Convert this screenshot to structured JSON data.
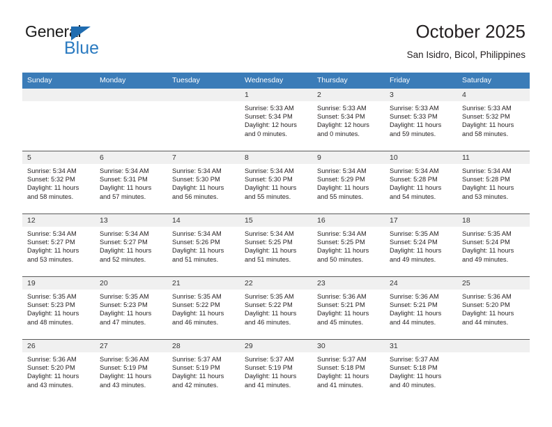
{
  "brand": {
    "name_top": "General",
    "name_bottom": "Blue",
    "accent_color": "#2a7ac0",
    "triangle_color": "#1f6cb0"
  },
  "header": {
    "title": "October 2025",
    "subtitle": "San Isidro, Bicol, Philippines",
    "header_bar_color": "#3b7cb8",
    "daynum_band_color": "#f0f0f0"
  },
  "weekdays": [
    "Sunday",
    "Monday",
    "Tuesday",
    "Wednesday",
    "Thursday",
    "Friday",
    "Saturday"
  ],
  "labels": {
    "sunrise_prefix": "Sunrise: ",
    "sunset_prefix": "Sunset: ",
    "daylight_prefix": "Daylight: "
  },
  "weeks": [
    [
      {
        "day": "",
        "sunrise": "",
        "sunset": "",
        "daylight": "",
        "empty": true
      },
      {
        "day": "",
        "sunrise": "",
        "sunset": "",
        "daylight": "",
        "empty": true
      },
      {
        "day": "",
        "sunrise": "",
        "sunset": "",
        "daylight": "",
        "empty": true
      },
      {
        "day": "1",
        "sunrise": "Sunrise: 5:33 AM",
        "sunset": "Sunset: 5:34 PM",
        "daylight": "Daylight: 12 hours and 0 minutes."
      },
      {
        "day": "2",
        "sunrise": "Sunrise: 5:33 AM",
        "sunset": "Sunset: 5:34 PM",
        "daylight": "Daylight: 12 hours and 0 minutes."
      },
      {
        "day": "3",
        "sunrise": "Sunrise: 5:33 AM",
        "sunset": "Sunset: 5:33 PM",
        "daylight": "Daylight: 11 hours and 59 minutes."
      },
      {
        "day": "4",
        "sunrise": "Sunrise: 5:33 AM",
        "sunset": "Sunset: 5:32 PM",
        "daylight": "Daylight: 11 hours and 58 minutes."
      }
    ],
    [
      {
        "day": "5",
        "sunrise": "Sunrise: 5:34 AM",
        "sunset": "Sunset: 5:32 PM",
        "daylight": "Daylight: 11 hours and 58 minutes."
      },
      {
        "day": "6",
        "sunrise": "Sunrise: 5:34 AM",
        "sunset": "Sunset: 5:31 PM",
        "daylight": "Daylight: 11 hours and 57 minutes."
      },
      {
        "day": "7",
        "sunrise": "Sunrise: 5:34 AM",
        "sunset": "Sunset: 5:30 PM",
        "daylight": "Daylight: 11 hours and 56 minutes."
      },
      {
        "day": "8",
        "sunrise": "Sunrise: 5:34 AM",
        "sunset": "Sunset: 5:30 PM",
        "daylight": "Daylight: 11 hours and 55 minutes."
      },
      {
        "day": "9",
        "sunrise": "Sunrise: 5:34 AM",
        "sunset": "Sunset: 5:29 PM",
        "daylight": "Daylight: 11 hours and 55 minutes."
      },
      {
        "day": "10",
        "sunrise": "Sunrise: 5:34 AM",
        "sunset": "Sunset: 5:28 PM",
        "daylight": "Daylight: 11 hours and 54 minutes."
      },
      {
        "day": "11",
        "sunrise": "Sunrise: 5:34 AM",
        "sunset": "Sunset: 5:28 PM",
        "daylight": "Daylight: 11 hours and 53 minutes."
      }
    ],
    [
      {
        "day": "12",
        "sunrise": "Sunrise: 5:34 AM",
        "sunset": "Sunset: 5:27 PM",
        "daylight": "Daylight: 11 hours and 53 minutes."
      },
      {
        "day": "13",
        "sunrise": "Sunrise: 5:34 AM",
        "sunset": "Sunset: 5:27 PM",
        "daylight": "Daylight: 11 hours and 52 minutes."
      },
      {
        "day": "14",
        "sunrise": "Sunrise: 5:34 AM",
        "sunset": "Sunset: 5:26 PM",
        "daylight": "Daylight: 11 hours and 51 minutes."
      },
      {
        "day": "15",
        "sunrise": "Sunrise: 5:34 AM",
        "sunset": "Sunset: 5:25 PM",
        "daylight": "Daylight: 11 hours and 51 minutes."
      },
      {
        "day": "16",
        "sunrise": "Sunrise: 5:34 AM",
        "sunset": "Sunset: 5:25 PM",
        "daylight": "Daylight: 11 hours and 50 minutes."
      },
      {
        "day": "17",
        "sunrise": "Sunrise: 5:35 AM",
        "sunset": "Sunset: 5:24 PM",
        "daylight": "Daylight: 11 hours and 49 minutes."
      },
      {
        "day": "18",
        "sunrise": "Sunrise: 5:35 AM",
        "sunset": "Sunset: 5:24 PM",
        "daylight": "Daylight: 11 hours and 49 minutes."
      }
    ],
    [
      {
        "day": "19",
        "sunrise": "Sunrise: 5:35 AM",
        "sunset": "Sunset: 5:23 PM",
        "daylight": "Daylight: 11 hours and 48 minutes."
      },
      {
        "day": "20",
        "sunrise": "Sunrise: 5:35 AM",
        "sunset": "Sunset: 5:23 PM",
        "daylight": "Daylight: 11 hours and 47 minutes."
      },
      {
        "day": "21",
        "sunrise": "Sunrise: 5:35 AM",
        "sunset": "Sunset: 5:22 PM",
        "daylight": "Daylight: 11 hours and 46 minutes."
      },
      {
        "day": "22",
        "sunrise": "Sunrise: 5:35 AM",
        "sunset": "Sunset: 5:22 PM",
        "daylight": "Daylight: 11 hours and 46 minutes."
      },
      {
        "day": "23",
        "sunrise": "Sunrise: 5:36 AM",
        "sunset": "Sunset: 5:21 PM",
        "daylight": "Daylight: 11 hours and 45 minutes."
      },
      {
        "day": "24",
        "sunrise": "Sunrise: 5:36 AM",
        "sunset": "Sunset: 5:21 PM",
        "daylight": "Daylight: 11 hours and 44 minutes."
      },
      {
        "day": "25",
        "sunrise": "Sunrise: 5:36 AM",
        "sunset": "Sunset: 5:20 PM",
        "daylight": "Daylight: 11 hours and 44 minutes."
      }
    ],
    [
      {
        "day": "26",
        "sunrise": "Sunrise: 5:36 AM",
        "sunset": "Sunset: 5:20 PM",
        "daylight": "Daylight: 11 hours and 43 minutes."
      },
      {
        "day": "27",
        "sunrise": "Sunrise: 5:36 AM",
        "sunset": "Sunset: 5:19 PM",
        "daylight": "Daylight: 11 hours and 43 minutes."
      },
      {
        "day": "28",
        "sunrise": "Sunrise: 5:37 AM",
        "sunset": "Sunset: 5:19 PM",
        "daylight": "Daylight: 11 hours and 42 minutes."
      },
      {
        "day": "29",
        "sunrise": "Sunrise: 5:37 AM",
        "sunset": "Sunset: 5:19 PM",
        "daylight": "Daylight: 11 hours and 41 minutes."
      },
      {
        "day": "30",
        "sunrise": "Sunrise: 5:37 AM",
        "sunset": "Sunset: 5:18 PM",
        "daylight": "Daylight: 11 hours and 41 minutes."
      },
      {
        "day": "31",
        "sunrise": "Sunrise: 5:37 AM",
        "sunset": "Sunset: 5:18 PM",
        "daylight": "Daylight: 11 hours and 40 minutes."
      },
      {
        "day": "",
        "sunrise": "",
        "sunset": "",
        "daylight": "",
        "empty": true
      }
    ]
  ]
}
